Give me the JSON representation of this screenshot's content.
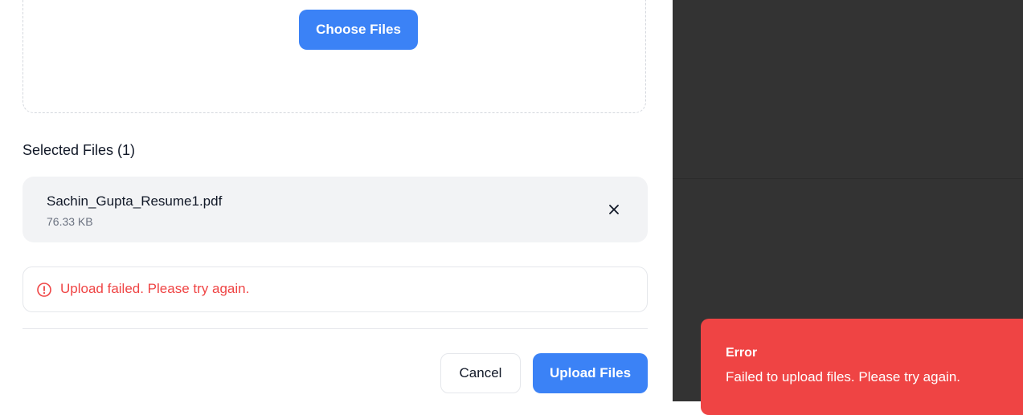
{
  "upload": {
    "choose_button_label": "Choose Files"
  },
  "selected": {
    "title": "Selected Files (1)",
    "files": [
      {
        "name": "Sachin_Gupta_Resume1.pdf",
        "size": "76.33 KB",
        "remove_icon": "close-icon"
      }
    ]
  },
  "error": {
    "icon": "alert-circle-icon",
    "message": "Upload failed. Please try again."
  },
  "footer": {
    "cancel_label": "Cancel",
    "upload_label": "Upload Files"
  },
  "toast": {
    "title": "Error",
    "message": "Failed to upload files. Please try again."
  },
  "colors": {
    "primary": "#3b82f6",
    "error": "#ef4444",
    "overlay": "#333333"
  }
}
